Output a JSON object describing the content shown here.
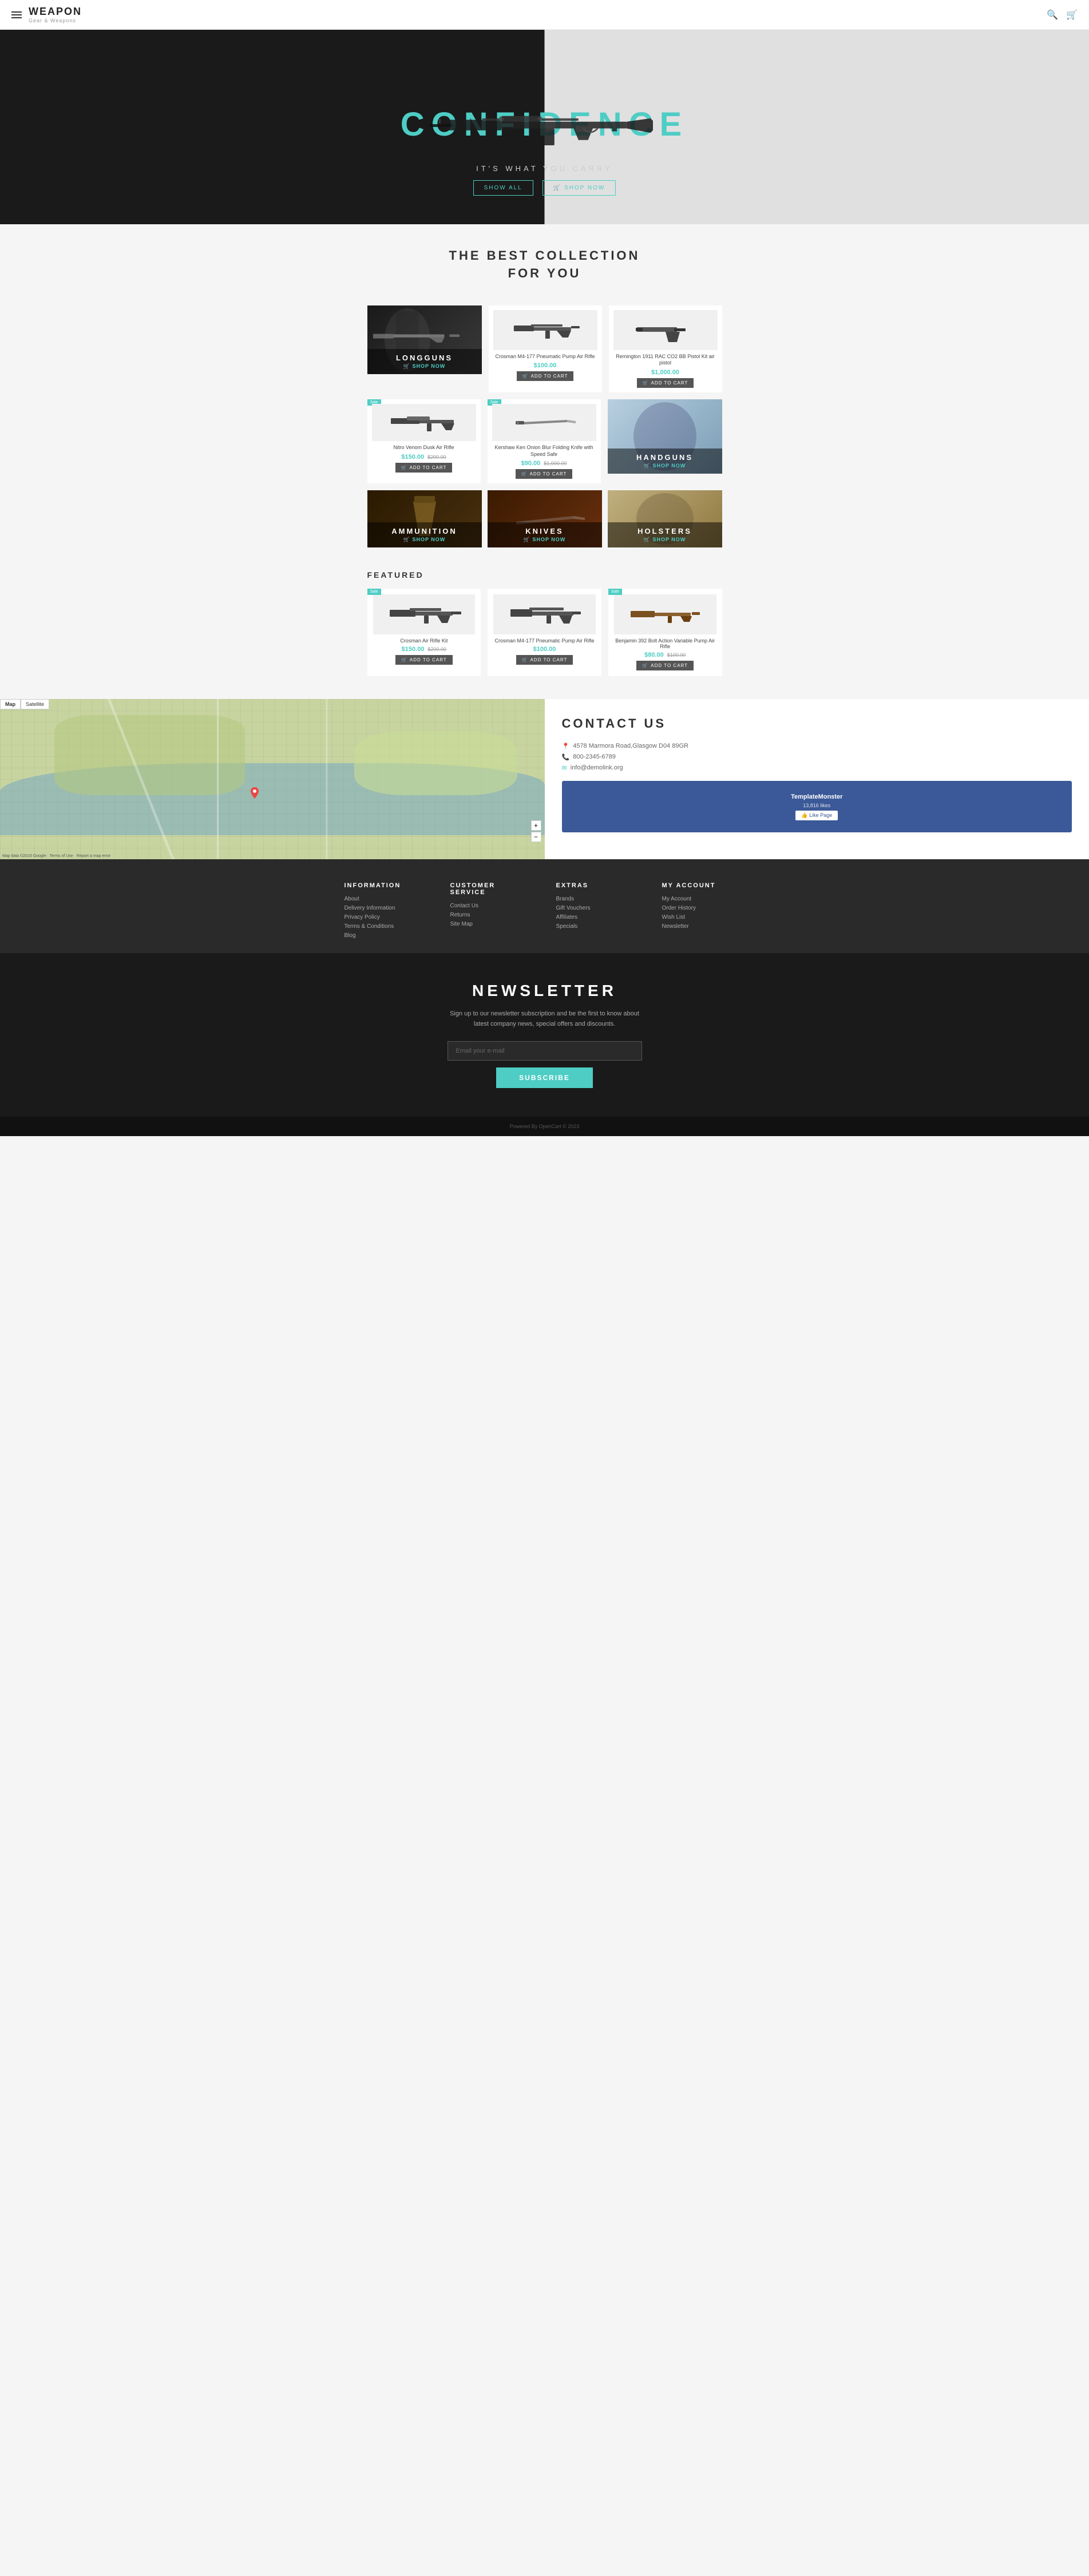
{
  "header": {
    "logo": "WEAPON",
    "logo_sub": "Gear & Weapons"
  },
  "hero": {
    "title": "CONFIDENCE",
    "subtitle": "IT'S WHAT YOU CARRY",
    "btn_show_all": "SHOW ALL",
    "btn_shop_now": "SHOP NOW"
  },
  "collection_section": {
    "title": "THE BEST COLLECTION\nFOR YOU"
  },
  "categories": {
    "longguns": {
      "label": "LONGGUNS",
      "shop_label": "SHOP NOW"
    },
    "handguns": {
      "label": "HANDGUNS",
      "shop_label": "SHOP NOW"
    },
    "ammunition": {
      "label": "AMMUNITION",
      "shop_label": "SHOP NOW"
    },
    "knives": {
      "label": "KNIVES",
      "shop_label": "SHOP NOW"
    },
    "holsters": {
      "label": "HOLSTERS",
      "shop_label": "SHOP NOW"
    }
  },
  "products": [
    {
      "id": "p1",
      "name": "Crosman M4-177 Pneumatic Pump Air Rifle",
      "price": "$100.00",
      "old_price": null,
      "sale": false,
      "add_to_cart": "Add to Cart"
    },
    {
      "id": "p2",
      "name": "Remington 1911 RAC CO2 BB Pistol Kit air pistol",
      "price": "$1,000.00",
      "old_price": null,
      "sale": false,
      "add_to_cart": "Add to Cart"
    },
    {
      "id": "p3",
      "name": "Nitro Venom Dusk Air Rifle",
      "price": "$150.00",
      "old_price": "$200.00",
      "sale": true,
      "add_to_cart": "Add to Cart"
    },
    {
      "id": "p4",
      "name": "Kershaw Ken Onion Blur Folding Knife with Speed Safe",
      "price": "$90.00",
      "old_price": "$1,000.00",
      "sale": true,
      "add_to_cart": "Add to Cart"
    }
  ],
  "featured": {
    "title": "FEATURED",
    "products": [
      {
        "id": "f1",
        "name": "Crosman Air Rifle Kit",
        "price": "$150.00",
        "old_price": "$200.00",
        "sale": true,
        "add_to_cart": "Add to Cart"
      },
      {
        "id": "f2",
        "name": "Crosman M4-177 Pneumatic Pump Air Rifle",
        "price": "$100.00",
        "old_price": null,
        "sale": false,
        "add_to_cart": "Add to Cart"
      },
      {
        "id": "f3",
        "name": "Benjamin 392 Bolt Action Variable Pump Air Rifle",
        "price": "$80.00",
        "old_price": "$100.00",
        "sale": true,
        "add_to_cart": "Add to Cart"
      }
    ]
  },
  "contact": {
    "title": "CONTACT US",
    "address": "4578 Marmora Road,Glasgow D04 89GR",
    "phone": "800-2345-6789",
    "email": "info@demolink.org",
    "address_icon": "📍",
    "phone_icon": "📞",
    "email_icon": "✉"
  },
  "newsletter": {
    "title": "NEWSLETTER",
    "description": "Sign up to our newsletter subscription and be the first to know about latest company news, special offers and discounts.",
    "email_placeholder": "Email your e-mail",
    "subscribe_label": "SUBSCRIBE"
  },
  "footer": {
    "information": {
      "title": "INFORMATION",
      "links": [
        "About",
        "Delivery Information",
        "Privacy Policy",
        "Terms & Conditions",
        "Blog"
      ]
    },
    "customer_service": {
      "title": "CUSTOMER SERVICE",
      "links": [
        "Contact Us",
        "Returns",
        "Site Map"
      ]
    },
    "extras": {
      "title": "EXTRAS",
      "links": [
        "Brands",
        "Gift Vouchers",
        "Affiliates",
        "Specials"
      ]
    },
    "my_account": {
      "title": "MY ACCOUNT",
      "links": [
        "My Account",
        "Order History",
        "Wish List",
        "Newsletter"
      ]
    },
    "copyright": "Powered By OpenCart © 2023"
  },
  "map_tabs": [
    "Map",
    "Satellite"
  ]
}
